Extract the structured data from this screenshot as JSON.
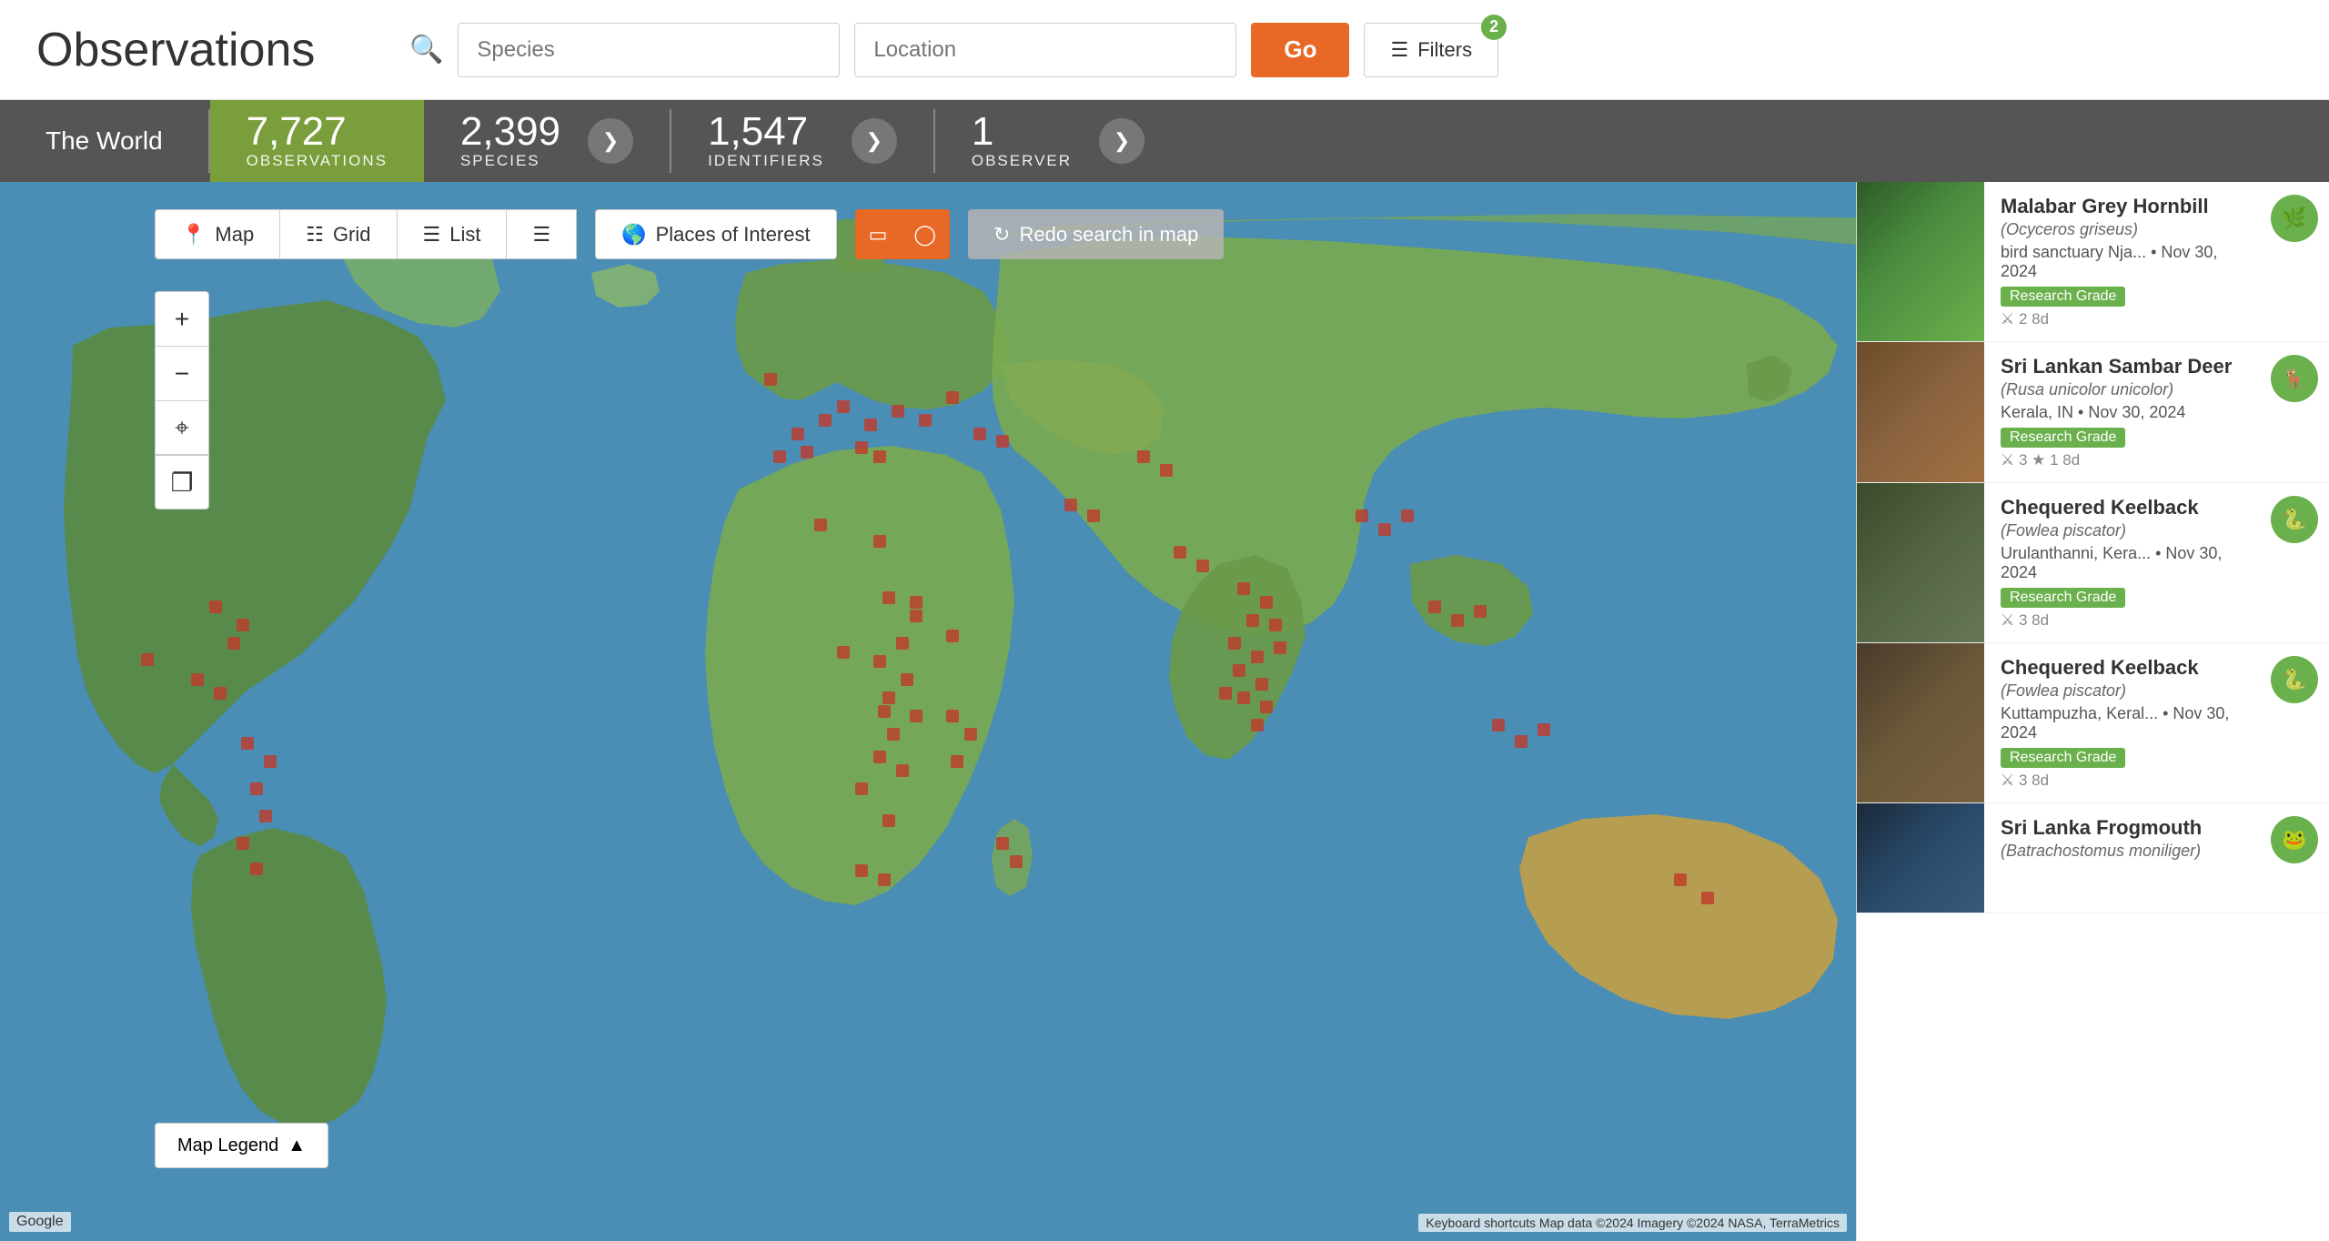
{
  "header": {
    "title": "Observations",
    "species_placeholder": "Species",
    "location_placeholder": "Location",
    "go_label": "Go",
    "filters_label": "Filters",
    "filters_badge": "2"
  },
  "stats_bar": {
    "location": "The World",
    "observations": {
      "number": "7,727",
      "label": "OBSERVATIONS"
    },
    "species": {
      "number": "2,399",
      "label": "SPECIES"
    },
    "identifiers": {
      "number": "1,547",
      "label": "IDENTIFIERS"
    },
    "observer": {
      "number": "1",
      "label": "OBSERVER"
    }
  },
  "toolbar": {
    "map_label": "Map",
    "grid_label": "Grid",
    "list_label": "List",
    "poi_label": "Places of Interest",
    "redo_label": "Redo search in map",
    "legend_label": "Map Legend"
  },
  "observations": [
    {
      "id": 1,
      "name": "Malabar Grey Hornbill",
      "scientific": "(Ocyceros griseus)",
      "location_line": "bird sanctuary Nja...",
      "date": "Nov 30, 2024",
      "grade": "Research Grade",
      "identifiers": "2",
      "days": "8d",
      "thumb_class": "thumb-hornbill",
      "avatar_char": "🌿"
    },
    {
      "id": 2,
      "name": "Sri Lankan Sambar Deer",
      "scientific": "(Rusa unicolor unicolor)",
      "location_line": "Kerala, IN",
      "date": "Nov 30, 2024",
      "grade": "Research Grade",
      "identifiers": "3",
      "stars": "1",
      "days": "8d",
      "thumb_class": "thumb-deer",
      "avatar_char": "🦌"
    },
    {
      "id": 3,
      "name": "Chequered Keelback",
      "scientific": "(Fowlea piscator)",
      "location_line": "Urulanthanni, Kera...",
      "date": "Nov 30, 2024",
      "grade": "Research Grade",
      "identifiers": "3",
      "days": "8d",
      "thumb_class": "thumb-snake1",
      "avatar_char": "🐍"
    },
    {
      "id": 4,
      "name": "Chequered Keelback",
      "scientific": "(Fowlea piscator)",
      "location_line": "Kuttampuzha, Keral...",
      "date": "Nov 30, 2024",
      "grade": "Research Grade",
      "identifiers": "3",
      "days": "8d",
      "thumb_class": "thumb-snake2",
      "avatar_char": "🐍"
    },
    {
      "id": 5,
      "name": "Sri Lanka Frogmouth",
      "scientific": "(Batrachostomus moniliger)",
      "location_line": "",
      "date": "",
      "grade": "",
      "identifiers": "",
      "days": "",
      "thumb_class": "thumb-frog",
      "avatar_char": "🐸"
    }
  ],
  "map": {
    "attribution": "Google",
    "attribution2": "Keyboard shortcuts  Map data ©2024 Imagery ©2024 NASA, TerraMetrics"
  },
  "colors": {
    "accent_orange": "#e86826",
    "accent_green": "#6ab04c",
    "stats_green": "#7a9e3b",
    "stats_dark": "#555555"
  }
}
